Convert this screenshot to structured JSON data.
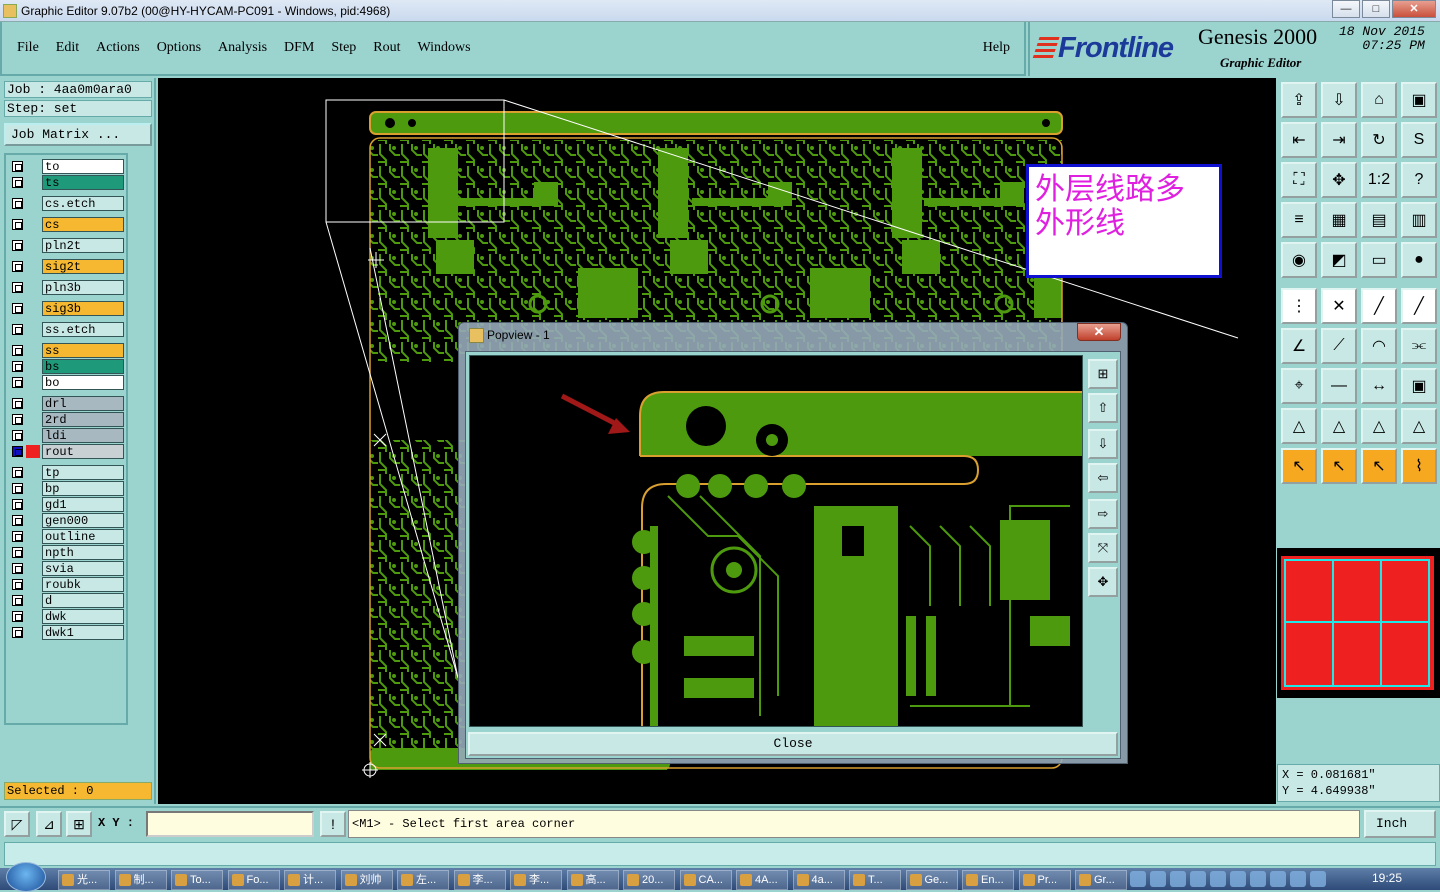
{
  "window": {
    "title": "Graphic Editor 9.07b2 (00@HY-HYCAM-PC091 - Windows, pid:4968)",
    "min": "—",
    "max": "□",
    "close": "✕"
  },
  "menu": {
    "items": [
      "File",
      "Edit",
      "Actions",
      "Options",
      "Analysis",
      "DFM",
      "Step",
      "Rout",
      "Windows"
    ],
    "help": "Help"
  },
  "brand": {
    "logo": "Frontline",
    "product": "Genesis 2000",
    "subtitle": "Graphic Editor",
    "date": "18 Nov 2015",
    "time": "07:25 PM"
  },
  "job": {
    "job_line": "Job : 4aa0m0ara0",
    "step_line": "Step: set",
    "matrix_button": "Job Matrix ..."
  },
  "layers": [
    {
      "name": "to",
      "color": "#ffffff"
    },
    {
      "name": "ts",
      "color": "#1e9a7a"
    },
    {
      "name": "cs.etch",
      "color": "#c8e8e6"
    },
    {
      "name": "cs",
      "color": "#f5b830"
    },
    {
      "name": "pln2t",
      "color": "#c8e8e6"
    },
    {
      "name": "sig2t",
      "color": "#f5b830"
    },
    {
      "name": "pln3b",
      "color": "#c8e8e6"
    },
    {
      "name": "sig3b",
      "color": "#f5b830"
    },
    {
      "name": "ss.etch",
      "color": "#c8e8e6"
    },
    {
      "name": "ss",
      "color": "#f5b830"
    },
    {
      "name": "bs",
      "color": "#1e9a7a"
    },
    {
      "name": "bo",
      "color": "#ffffff"
    },
    {
      "name": "drl",
      "color": "#a8b8c0"
    },
    {
      "name": "2rd",
      "color": "#a8b8c0"
    },
    {
      "name": "ldi",
      "color": "#a8b8c0"
    },
    {
      "name": "rout",
      "color": "#c8d0d4"
    },
    {
      "name": "tp",
      "color": "#c8e8e6"
    },
    {
      "name": "bp",
      "color": "#c8e8e6"
    },
    {
      "name": "gd1",
      "color": "#c8e8e6"
    },
    {
      "name": "gen000",
      "color": "#c8e8e6"
    },
    {
      "name": "outline",
      "color": "#c8e8e6"
    },
    {
      "name": "npth",
      "color": "#c8e8e6"
    },
    {
      "name": "svia",
      "color": "#c8e8e6"
    },
    {
      "name": "roubk",
      "color": "#c8e8e6"
    },
    {
      "name": "d",
      "color": "#c8e8e6"
    },
    {
      "name": "dwk",
      "color": "#c8e8e6"
    },
    {
      "name": "dwk1",
      "color": "#c8e8e6"
    }
  ],
  "selected": "Selected : 0",
  "annotation": "外层线路多外形线",
  "popview": {
    "title": "Popview - 1",
    "close_label": "Close",
    "x": "✕"
  },
  "coords": {
    "x": "X = 0.081681\"",
    "y": "Y = 4.649938\""
  },
  "status": {
    "xy_label": "X Y :",
    "xy_value": "",
    "message": "<M1> - Select first area corner",
    "unit": "Inch",
    "warn": "!"
  },
  "taskbar": {
    "items": [
      "光...",
      "制...",
      "To...",
      "Fo...",
      "计...",
      "刘帅",
      "左...",
      "李...",
      "李...",
      "高...",
      "20...",
      "CA...",
      "4A...",
      "4a...",
      "T...",
      "Ge...",
      "En...",
      "Pr...",
      "Gr..."
    ],
    "clock": "19:25"
  },
  "colors": {
    "board_green": "#4e9a0e",
    "outline_gold": "#d9a030",
    "accent_red": "#ee2020"
  }
}
